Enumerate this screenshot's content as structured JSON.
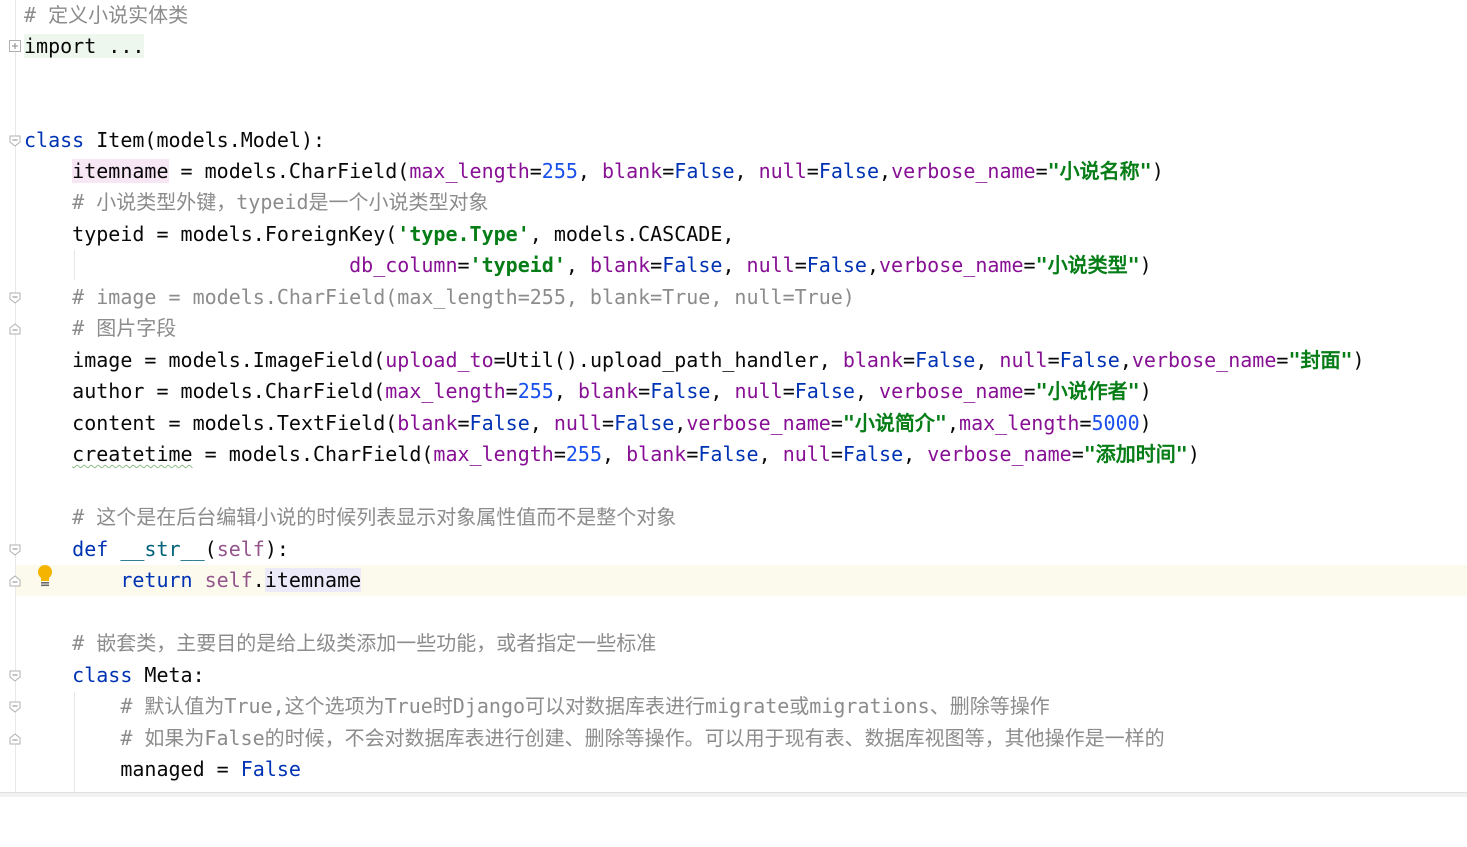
{
  "colors": {
    "keyword": "#0033b3",
    "string": "#067d17",
    "number": "#1750eb",
    "param": "#871094",
    "comment": "#8c8c8c",
    "caret_line": "#fcfaed"
  },
  "lines": {
    "l1": "# 定义小说实体类",
    "l2": "import ...",
    "l5_kw": "class",
    "l5_rest": " Item(models.Model):",
    "l6_name": "itemname",
    "l6_a": " = models.CharField(",
    "l6_p1": "max_length",
    "l6_n1": "255",
    "l6_p2": "blank",
    "l6_v2": "False",
    "l6_p3": "null",
    "l6_v3": "False",
    "l6_p4": "verbose_name",
    "l6_s4": "\"小说名称\"",
    "l7": "# 小说类型外键，typeid是一个小说类型对象",
    "l8_a": "typeid = models.ForeignKey(",
    "l8_s1": "'type.Type'",
    "l8_b": ", models.CASCADE,",
    "l9_p1": "db_column",
    "l9_s1": "'typeid'",
    "l9_p2": "blank",
    "l9_v2": "False",
    "l9_p3": "null",
    "l9_v3": "False",
    "l9_p4": "verbose_name",
    "l9_s4": "\"小说类型\"",
    "l10": "# image = models.CharField(max_length=255, blank=True, null=True)",
    "l11": "# 图片字段",
    "l12_a": "image = models.ImageField(",
    "l12_p1": "upload_to",
    "l12_b": "=Util().upload_path_handler, ",
    "l12_p2": "blank",
    "l12_v2": "False",
    "l12_p3": "null",
    "l12_v3": "False",
    "l12_p4": "verbose_name",
    "l12_s4": "\"封面\"",
    "l13_a": "author = models.CharField(",
    "l13_p1": "max_length",
    "l13_n1": "255",
    "l13_p2": "blank",
    "l13_v2": "False",
    "l13_p3": "null",
    "l13_v3": "False",
    "l13_p4": "verbose_name",
    "l13_s4": "\"小说作者\"",
    "l14_a": "content = models.TextField(",
    "l14_p1": "blank",
    "l14_v1": "False",
    "l14_p2": "null",
    "l14_v2": "False",
    "l14_p3": "verbose_name",
    "l14_s3": "\"小说简介\"",
    "l14_p4": "max_length",
    "l14_n4": "5000",
    "l15_name": "createtime",
    "l15_a": " = models.CharField(",
    "l15_p1": "max_length",
    "l15_n1": "255",
    "l15_p2": "blank",
    "l15_v2": "False",
    "l15_p3": "null",
    "l15_v3": "False",
    "l15_p4": "verbose_name",
    "l15_s4": "\"添加时间\"",
    "l17": "# 这个是在后台编辑小说的时候列表显示对象属性值而不是整个对象",
    "l18_kw": "def",
    "l18_fn": "__str__",
    "l18_self": "self",
    "l19_kw": "return",
    "l19_self": "self",
    "l19_attr": "itemname",
    "l21": "# 嵌套类，主要目的是给上级类添加一些功能，或者指定一些标准",
    "l22_kw": "class",
    "l22_rest": " Meta:",
    "l23": "# 默认值为True,这个选项为True时Django可以对数据库表进行migrate或migrations、删除等操作",
    "l24": "# 如果为False的时候，不会对数据库表进行创建、删除等操作。可以用于现有表、数据库视图等，其他操作是一样的",
    "l25_a": "managed = ",
    "l25_v": "False"
  }
}
